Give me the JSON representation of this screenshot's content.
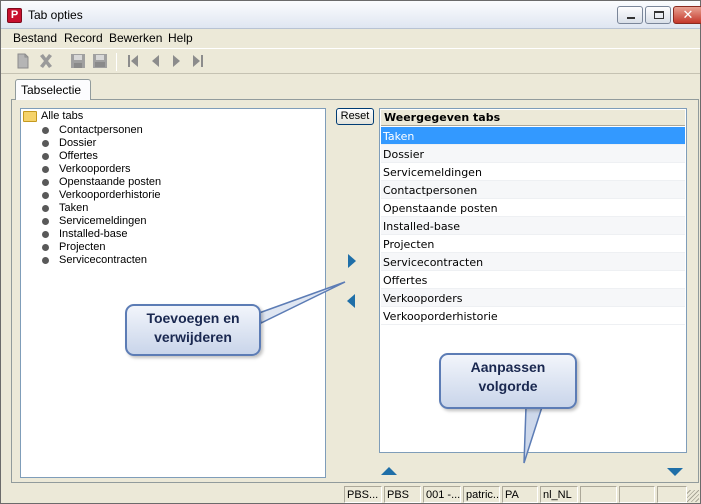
{
  "window": {
    "title": "Tab opties",
    "app_icon_letter": "P"
  },
  "menu": [
    "Bestand",
    "Record",
    "Bewerken",
    "Help"
  ],
  "toolbar": {
    "icons": [
      "new-record-icon",
      "delete-record-icon",
      "save-icon",
      "save-all-icon",
      "first-record-icon",
      "previous-record-icon",
      "next-record-icon",
      "last-record-icon"
    ]
  },
  "tab_label": "Tabselectie",
  "tree": {
    "root": "Alle tabs",
    "items": [
      "Contactpersonen",
      "Dossier",
      "Offertes",
      "Verkooporders",
      "Openstaande posten",
      "Verkooporderhistorie",
      "Taken",
      "Servicemeldingen",
      "Installed-base",
      "Projecten",
      "Servicecontracten"
    ]
  },
  "reset_label": "Reset",
  "list": {
    "header": "Weergegeven tabs",
    "selected": "Taken",
    "items": [
      "Taken",
      "Dossier",
      "Servicemeldingen",
      "Contactpersonen",
      "Openstaande posten",
      "Installed-base",
      "Projecten",
      "Servicecontracten",
      "Offertes",
      "Verkooporders",
      "Verkooporderhistorie"
    ]
  },
  "callouts": {
    "add_remove": {
      "line1": "Toevoegen en",
      "line2": "verwijderen"
    },
    "reorder": {
      "line1": "Aanpassen",
      "line2": "volgorde"
    }
  },
  "status": [
    "PBS...",
    "PBS",
    "001 -...",
    "patric...",
    "PA",
    "nl_NL",
    "",
    "",
    ""
  ],
  "colors": {
    "accent": "#1f6fa8",
    "selection": "#3399ff",
    "callout_border": "#5c7cb5"
  }
}
